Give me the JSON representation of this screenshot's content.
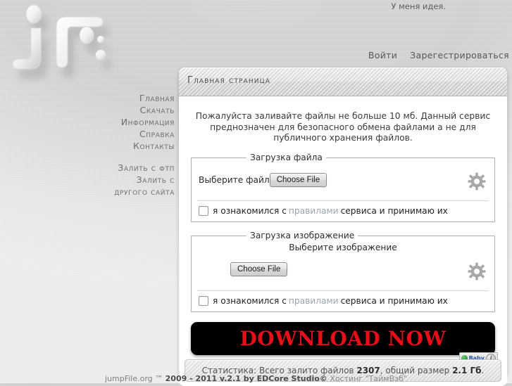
{
  "site": {
    "slogan": "У меня идея.",
    "logo_alt": "jumpFile logo"
  },
  "topnav": {
    "login": "Войти",
    "register": "Зарегестрироваться"
  },
  "sidebar": {
    "items": [
      {
        "label": "Главная"
      },
      {
        "label": "Скачать"
      },
      {
        "label": "Информация"
      },
      {
        "label": "Справка"
      },
      {
        "label": "Контакты"
      }
    ],
    "items2": [
      {
        "label": "Залить с фтп"
      },
      {
        "label": "Залить с"
      },
      {
        "label": "другого сайта"
      }
    ]
  },
  "panel": {
    "title": "Главная страница",
    "intro": "Пожалуйста заливайте файлы не больше 10 мб. Данный сервис преднозначен для безопасного обмена файлами а не для публичного хранения файлов.",
    "file_upload": {
      "legend": "Загрузка файла",
      "label": "Выберите файл",
      "button": "Choose File",
      "agree_pre": "я ознакомился с",
      "agree_link": "правилами",
      "agree_post": "сервиса и принимаю их",
      "gear_icon": "gear-icon"
    },
    "image_upload": {
      "legend": "Загрузка изображение",
      "caption": "Выберите изображение",
      "button": "Choose File",
      "agree_pre": "я ознакомился с",
      "agree_link": "правилами",
      "agree_post": "сервиса и принимаю их",
      "gear_icon": "gear-icon"
    },
    "download_banner": {
      "label": "DOWNLOAD NOW",
      "bg_color": "#000000",
      "text_color": "#e60e18"
    },
    "baby_badge": {
      "label": "Baby",
      "info": "i"
    },
    "stats": {
      "prefix": "Статистика: Всего залито файлов",
      "files_count": "2307",
      "middle": ", общий размер",
      "total_size": "2.1 Гб",
      "suffix": "."
    }
  },
  "footer": {
    "brand": "jumpFile.org ™",
    "years": "2009 - 2011 v.2.1 by EDCore Studio©",
    "hosting": "Хостинг \"ТаймВэб\""
  }
}
